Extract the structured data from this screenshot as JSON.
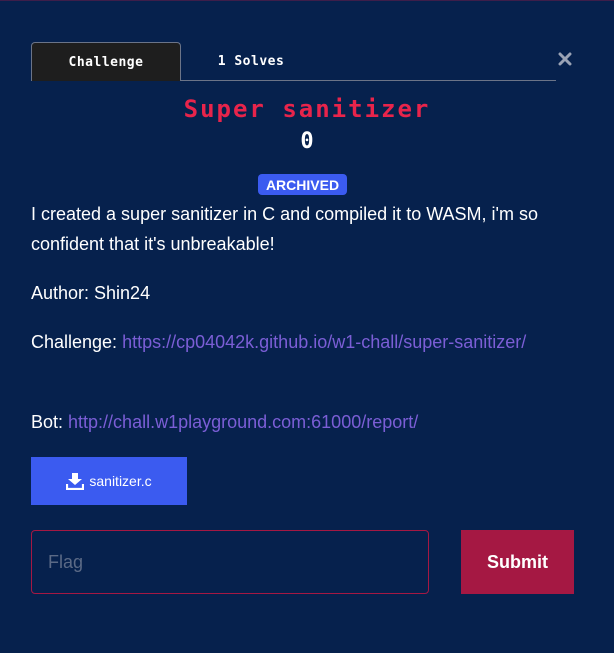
{
  "tabs": [
    {
      "label": "Challenge",
      "active": true
    },
    {
      "label": "1 Solves",
      "active": false
    }
  ],
  "close_icon": "close-icon",
  "challenge": {
    "title": "Super sanitizer",
    "points": "0",
    "status_badge": "ARCHIVED"
  },
  "description": {
    "intro": "I created a super sanitizer in C and compiled it to WASM, i'm so confident that it's unbreakable!",
    "author_line": "Author: Shin24",
    "challenge_label": "Challenge: ",
    "challenge_link": "https://cp04042k.github.io/w1-chall/super-sanitizer/",
    "bot_label": "Bot: ",
    "bot_link": "http://chall.w1playground.com:61000/report/"
  },
  "file": {
    "icon": "download-icon",
    "name": "sanitizer.c"
  },
  "flag_form": {
    "value": "",
    "placeholder": "Flag",
    "submit_label": "Submit"
  },
  "colors": {
    "background": "#06214d",
    "title": "#e8244b",
    "badge": "#3b5bf0",
    "link": "#7b5ed6",
    "submit": "#a51843",
    "file_button": "#3b5bf0"
  }
}
